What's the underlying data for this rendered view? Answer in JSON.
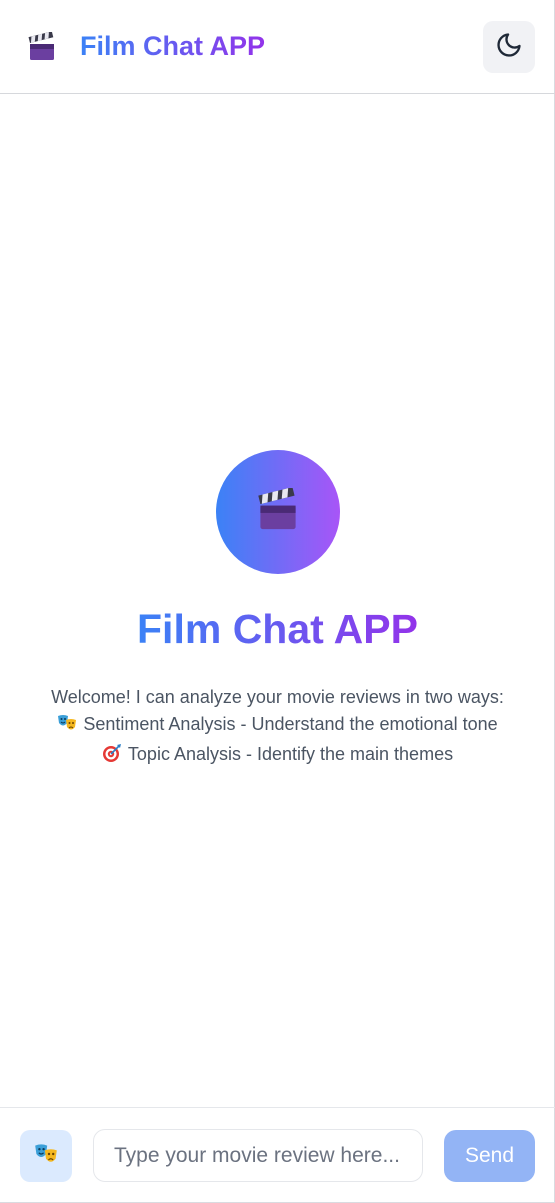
{
  "header": {
    "title": "Film Chat APP",
    "brand_icon": "clapperboard-icon",
    "theme_toggle_icon": "moon-icon"
  },
  "welcome": {
    "logo_icon": "clapperboard-icon",
    "title": "Film Chat APP",
    "intro": "Welcome! I can analyze your movie reviews in two ways:",
    "sentiment_line": "Sentiment Analysis - Understand the emotional tone",
    "sentiment_icon": "theater-masks-icon",
    "topic_line": "Topic Analysis - Identify the main themes",
    "topic_icon": "target-icon"
  },
  "input_bar": {
    "mode_icon": "theater-masks-icon",
    "placeholder": "Type your movie review here...",
    "value": "",
    "send_label": "Send"
  },
  "colors": {
    "gradient_start": "#3b82f6",
    "gradient_end": "#9333ea",
    "send_button": "#93b4f5",
    "mode_button": "#dbeafe"
  }
}
